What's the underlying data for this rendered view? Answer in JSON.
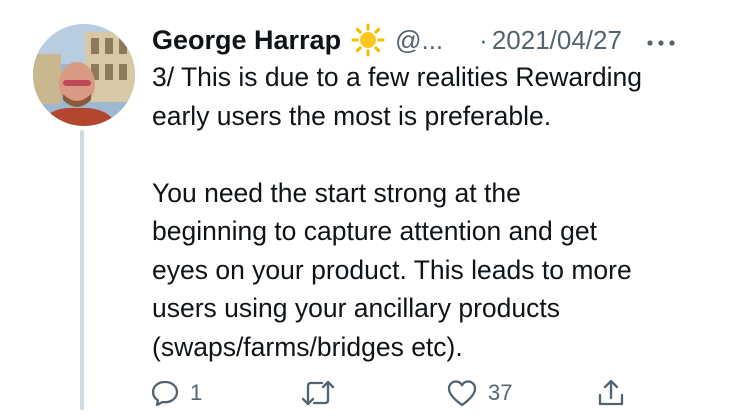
{
  "tweet": {
    "author_name": "George Harrap",
    "author_emoji_icon": "sun-icon",
    "handle": "@...",
    "separator": "·",
    "date": "2021/04/27",
    "more_icon": "more-horizontal-icon",
    "text": "3/ This is due to a few realities Rewarding\nearly users the most is preferable.\n\nYou need the start strong at the\nbeginning to capture attention and get\neyes on your product. This leads to more\nusers using your ancillary products\n(swaps/farms/bridges etc)."
  },
  "actions": {
    "reply": {
      "icon": "reply-icon",
      "count": "1"
    },
    "retweet": {
      "icon": "retweet-icon",
      "count": ""
    },
    "like": {
      "icon": "heart-icon",
      "count": "37"
    },
    "share": {
      "icon": "share-icon",
      "count": ""
    }
  },
  "colors": {
    "text": "#0f1419",
    "secondary": "#536471",
    "thread_line": "#cfd9de"
  }
}
